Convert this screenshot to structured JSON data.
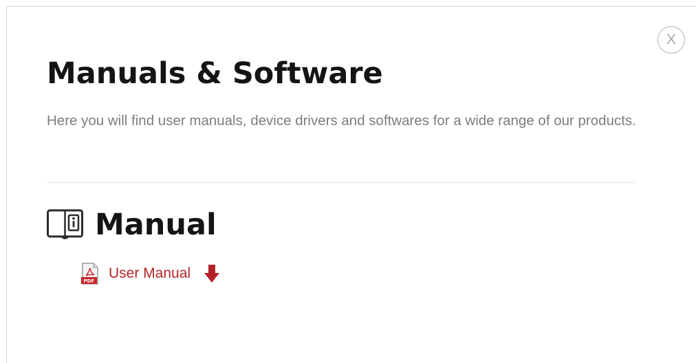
{
  "dialog": {
    "title": "Manuals & Software",
    "description": "Here you will find user manuals, device drivers and softwares for a wide range of our products.",
    "close_label": "X",
    "close_icon": "close-circle-icon"
  },
  "sections": [
    {
      "title": "Manual",
      "icon": "book-info-icon",
      "links": [
        {
          "label": "User Manual",
          "file_icon": "pdf-file-icon",
          "action_icon": "download-arrow-icon"
        }
      ]
    }
  ],
  "colors": {
    "accent": "#b32328",
    "heading": "#141414",
    "body_text": "#7d7d7d",
    "divider": "#e2e2e2",
    "close_border": "#b5b5b5"
  }
}
